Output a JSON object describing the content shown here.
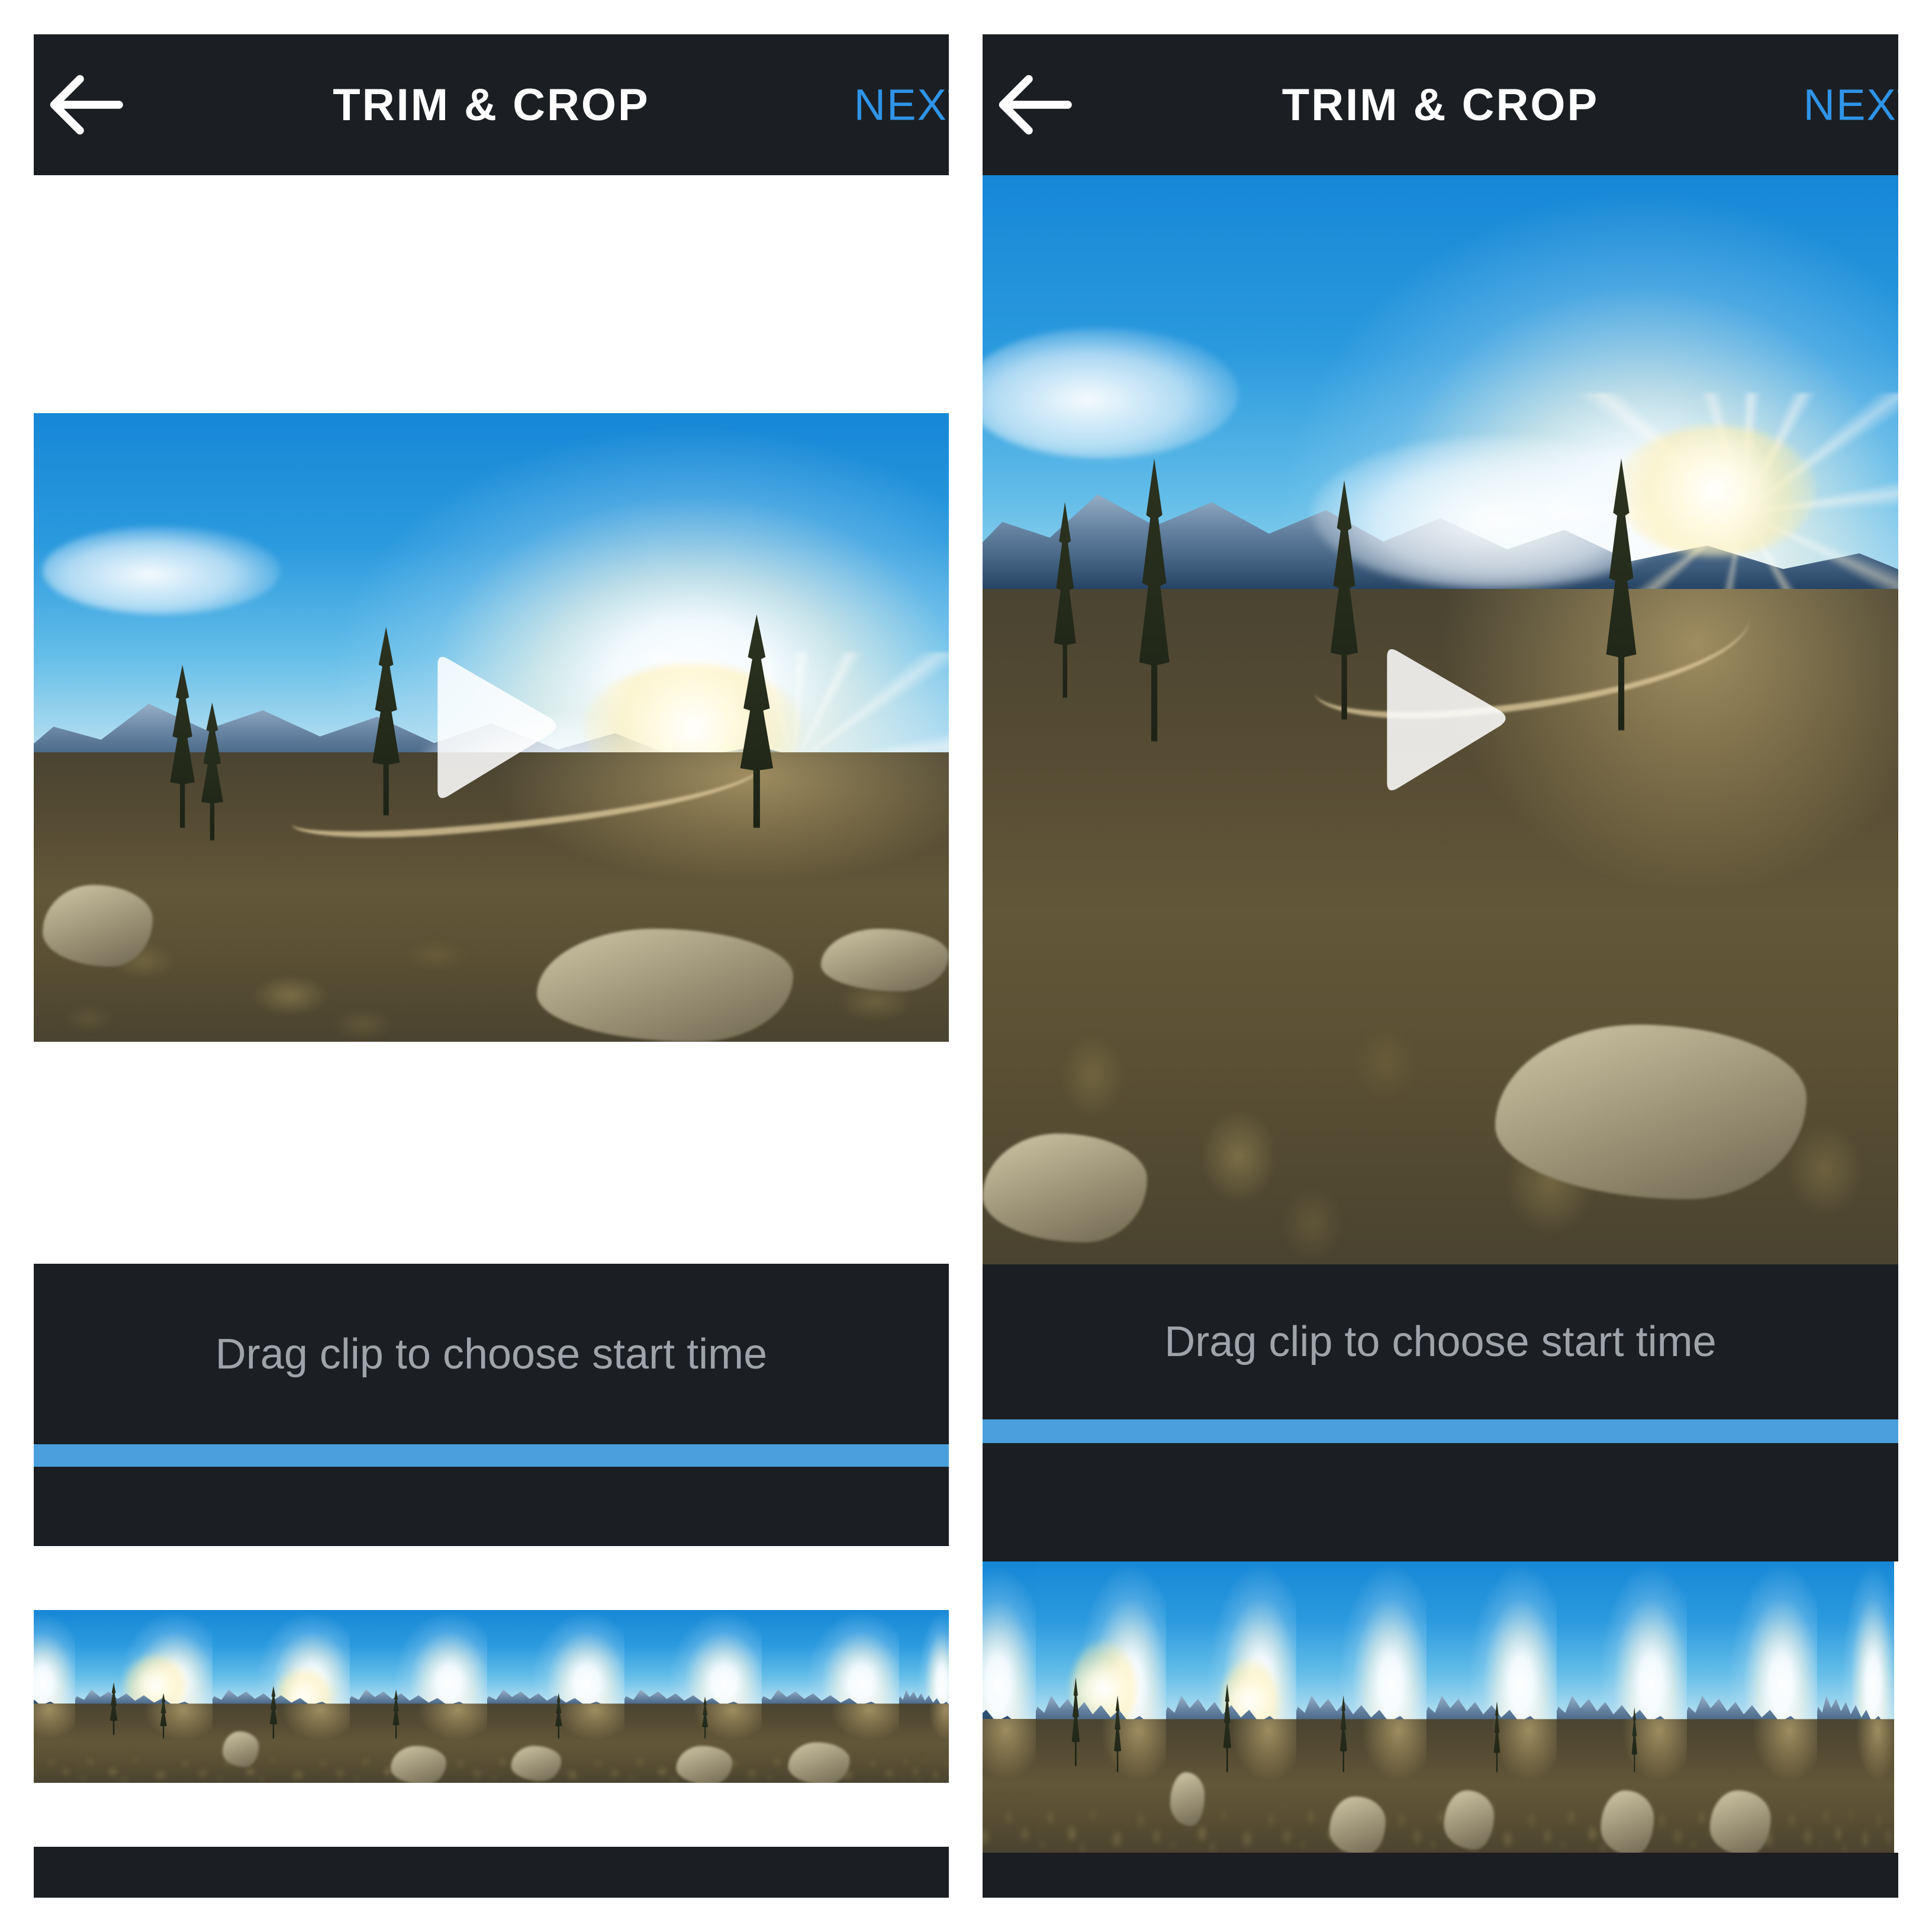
{
  "app": {
    "accent_blue": "#2f94e8",
    "bar_dark": "#1b1f23",
    "hint_gray": "#9ea4aa",
    "timeline_blue": "#4a9fdc"
  },
  "panels": [
    {
      "id": "left",
      "header": {
        "back_icon": "arrow-left-icon",
        "title": "TRIM & CROP",
        "next_label": "NEXT"
      },
      "preview": {
        "play_icon": "play-triangle-icon",
        "scene_description": "Sunset over snowy mountain range with pine trees, sagebrush and rocks"
      },
      "trim": {
        "hint": "Drag clip to choose start time",
        "thumbnail_count": 8
      }
    },
    {
      "id": "right",
      "header": {
        "back_icon": "arrow-left-icon",
        "title": "TRIM & CROP",
        "next_label": "NEXT"
      },
      "preview": {
        "play_icon": "play-triangle-icon",
        "scene_description": "Sunset over snowy mountain range with pine trees, sagebrush and rocks"
      },
      "trim": {
        "hint": "Drag clip to choose start time",
        "thumbnail_count": 8
      }
    }
  ]
}
